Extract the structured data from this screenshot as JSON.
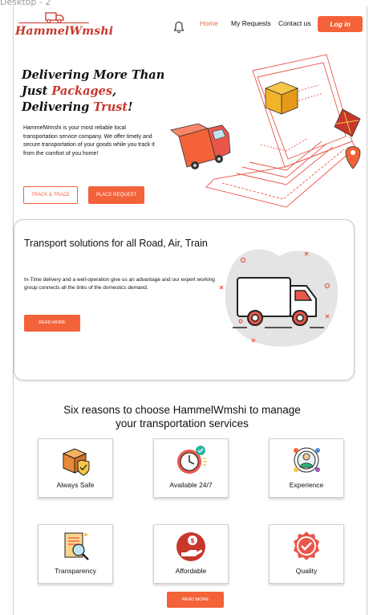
{
  "frame": {
    "label": "Desktop - 2"
  },
  "header": {
    "logo_text": "HammelWmshi",
    "nav": {
      "home": "Home",
      "requests": "My Requests",
      "contact": "Contact us"
    },
    "login_label": "Log in"
  },
  "hero": {
    "title_line1": "Delivering More Than",
    "title_just": "Just ",
    "title_packages": "Packages",
    "title_comma": ",",
    "title_delivering": "Delivering ",
    "title_trust": "Trust",
    "title_excl": "!",
    "description": "HammelWmshi is your most reliable local transportation service company. We offer timely and secure transportation of your goods while you track it from the comfort of you home!",
    "track_label": "TRACK & TRACE",
    "place_label": "PLACE REQUEST"
  },
  "transport": {
    "title": "Transport solutions for all Road, Air, Train",
    "description": "In-Time delivery and a well-operation give us an advantage and our expert working group connects all the links of the domestics demand.",
    "button_label": "READ MORE"
  },
  "reasons": {
    "title": "Six reasons to choose HammelWmshi to manage your transportation services",
    "items": [
      {
        "label": "Always Safe",
        "icon": "box-shield-icon"
      },
      {
        "label": "Available 24/7",
        "icon": "clock-icon"
      },
      {
        "label": "Experience",
        "icon": "person-network-icon"
      },
      {
        "label": "Transparency",
        "icon": "document-magnifier-icon"
      },
      {
        "label": "Affordable",
        "icon": "hand-coin-icon"
      },
      {
        "label": "Quality",
        "icon": "badge-check-icon"
      }
    ],
    "button_label": "READ MORE"
  },
  "colors": {
    "accent": "#f4623a",
    "brand": "#c7372b"
  }
}
